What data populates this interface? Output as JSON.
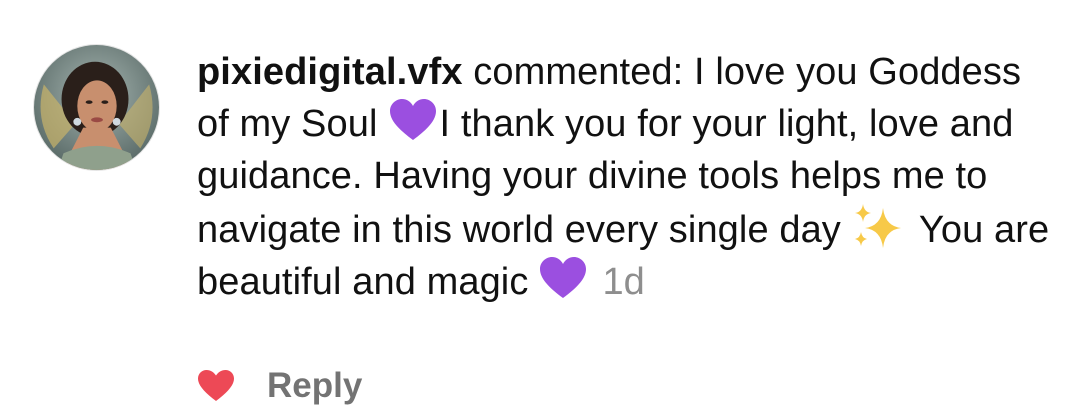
{
  "comment": {
    "username": "pixiedigital.vfx",
    "action_text": "commented:",
    "text_part1": "I love you Goddess of my Soul",
    "heart_emoji_icon": "purple-heart-icon",
    "text_part2": "I thank you for your light, love and guidance. Having your divine tools helps me to navigate in this world every single day",
    "sparkles_emoji_icon": "sparkles-icon",
    "text_part3": "You are beautiful and magic",
    "timestamp": "1d"
  },
  "actions": {
    "like_icon": "red-heart-icon",
    "reply_label": "Reply"
  },
  "colors": {
    "like_heart": "#ed4956",
    "purple_heart": "#9b4fe0",
    "sparkle": "#f7c948",
    "timestamp": "#8e8e8e",
    "reply": "#737373"
  }
}
